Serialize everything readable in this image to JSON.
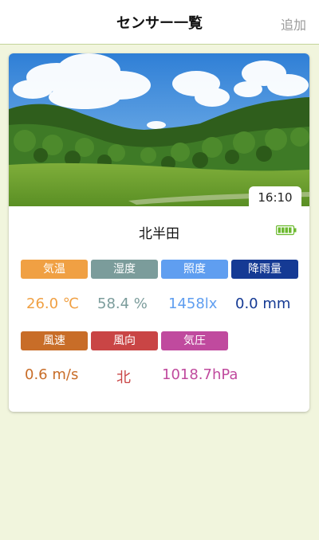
{
  "header": {
    "title": "センサー一覧",
    "add_label": "追加"
  },
  "card": {
    "time": "16:10",
    "location": "北半田",
    "battery_icon": "battery-full-icon",
    "sensors": [
      {
        "label": "気温",
        "value": "26.0 ℃",
        "label_color": "#f0a043",
        "value_color": "#f0a043"
      },
      {
        "label": "湿度",
        "value": "58.4 %",
        "label_color": "#7b9c9b",
        "value_color": "#7b9c9b"
      },
      {
        "label": "照度",
        "value": "1458lx",
        "label_color": "#5f9ef0",
        "value_color": "#5f9ef0"
      },
      {
        "label": "降雨量",
        "value": "0.0 mm",
        "label_color": "#153a94",
        "value_color": "#153a94"
      },
      {
        "label": "風速",
        "value": "0.6 m/s",
        "label_color": "#c86d28",
        "value_color": "#c86d28"
      },
      {
        "label": "風向",
        "value": "北",
        "label_color": "#c94545",
        "value_color": "#c94545"
      },
      {
        "label": "気圧",
        "value": "1018.7hPa",
        "label_color": "#c04a9e",
        "value_color": "#c04a9e"
      }
    ]
  }
}
